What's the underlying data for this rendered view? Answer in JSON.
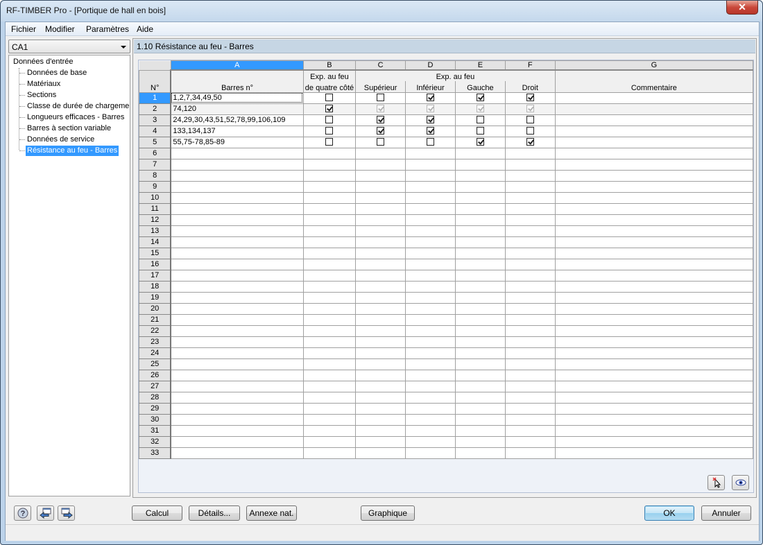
{
  "window": {
    "title": "RF-TIMBER Pro - [Portique de hall en bois]",
    "close_icon": "close-x-icon"
  },
  "menu": [
    "Fichier",
    "Modifier",
    "Paramètres",
    "Aide"
  ],
  "case_selector": {
    "value": "CA1"
  },
  "navigator": {
    "root": "Données d'entrée",
    "items": [
      {
        "label": "Données de base",
        "selected": false
      },
      {
        "label": "Matériaux",
        "selected": false
      },
      {
        "label": "Sections",
        "selected": false
      },
      {
        "label": "Classe de durée de chargement",
        "selected": false
      },
      {
        "label": "Longueurs efficaces - Barres",
        "selected": false
      },
      {
        "label": "Barres à section variable",
        "selected": false
      },
      {
        "label": "Données de service",
        "selected": false
      },
      {
        "label": "Résistance au feu - Barres",
        "selected": true
      }
    ]
  },
  "panel": {
    "title": "1.10 Résistance au feu - Barres"
  },
  "table": {
    "column_letters": [
      "A",
      "B",
      "C",
      "D",
      "E",
      "F",
      "G"
    ],
    "row_header_label": "N°",
    "group_header_b": "Exp. au feu",
    "group_header_b2": "de quatre côté",
    "group_header_cf": "Exp. au feu",
    "col_a": "Barres n°",
    "col_c": "Supérieur",
    "col_d": "Inférieur",
    "col_e": "Gauche",
    "col_f": "Droit",
    "col_g": "Commentaire",
    "rows": [
      {
        "n": "1",
        "barres": "1,2,7,34,49,50",
        "b": false,
        "c": false,
        "d": true,
        "e": true,
        "f": true,
        "disabled": false,
        "comment": ""
      },
      {
        "n": "2",
        "barres": "74,120",
        "b": true,
        "c": true,
        "d": true,
        "e": true,
        "f": true,
        "disabled": true,
        "comment": ""
      },
      {
        "n": "3",
        "barres": "24,29,30,43,51,52,78,99,106,109",
        "b": false,
        "c": true,
        "d": true,
        "e": false,
        "f": false,
        "disabled": false,
        "comment": ""
      },
      {
        "n": "4",
        "barres": "133,134,137",
        "b": false,
        "c": true,
        "d": true,
        "e": false,
        "f": false,
        "disabled": false,
        "comment": ""
      },
      {
        "n": "5",
        "barres": "55,75-78,85-89",
        "b": false,
        "c": false,
        "d": false,
        "e": true,
        "f": true,
        "disabled": false,
        "comment": ""
      }
    ],
    "empty_row_numbers": [
      "6",
      "7",
      "8",
      "9",
      "10",
      "11",
      "12",
      "13",
      "14",
      "15",
      "16",
      "17",
      "18",
      "19",
      "20",
      "21",
      "22",
      "23",
      "24",
      "25",
      "26",
      "27",
      "28",
      "29",
      "30",
      "31",
      "32",
      "33"
    ]
  },
  "grid_tools": [
    "pick-members-icon",
    "view-eye-icon"
  ],
  "bottom_icons": [
    "help-icon",
    "previous-window-icon",
    "next-window-icon"
  ],
  "buttons": {
    "calcul": "Calcul",
    "details": "Détails...",
    "annexe": "Annexe nat. ...",
    "graphique": "Graphique",
    "ok": "OK",
    "annuler": "Annuler"
  }
}
